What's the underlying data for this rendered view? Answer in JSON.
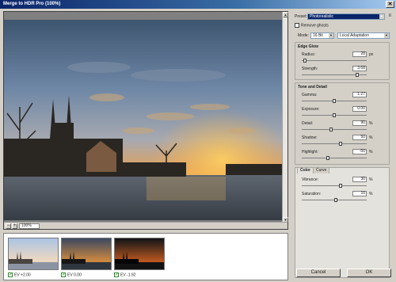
{
  "window": {
    "title": "Merge to HDR Pro (100%)",
    "close_label": "✕"
  },
  "preview": {
    "zoom": "100%",
    "zoom_minus": "−",
    "zoom_plus": "+"
  },
  "filmstrip": [
    {
      "label": "EV +2.00",
      "checked": true
    },
    {
      "label": "EV 0.00",
      "checked": true
    },
    {
      "label": "EV -1.92",
      "checked": true
    }
  ],
  "panel": {
    "preset_label": "Preset:",
    "preset_value": "Photorealistic",
    "remove_ghosts_label": "Remove ghosts",
    "mode_label": "Mode:",
    "mode_value": "16 Bit",
    "method_value": "Local Adaptation",
    "edge_glow": {
      "title": "Edge Glow",
      "radius": {
        "label": "Radius:",
        "value": "28",
        "unit": "px",
        "level": 0.05
      },
      "strength": {
        "label": "Strength:",
        "value": "3.68",
        "unit": "",
        "level": 0.85
      }
    },
    "tone_detail": {
      "title": "Tone and Detail",
      "gamma": {
        "label": "Gamma:",
        "value": "1.27",
        "unit": "",
        "level": 0.5
      },
      "exposure": {
        "label": "Exposure:",
        "value": "0.00",
        "unit": "",
        "level": 0.5
      },
      "detail": {
        "label": "Detail:",
        "value": "90",
        "unit": "%",
        "level": 0.45
      },
      "shadow": {
        "label": "Shadow:",
        "value": "50",
        "unit": "%",
        "level": 0.6
      },
      "highlight": {
        "label": "Highlight:",
        "value": "-50",
        "unit": "%",
        "level": 0.4
      }
    },
    "tabs": {
      "color": "Color",
      "curve": "Curve"
    },
    "color": {
      "vibrance": {
        "label": "Vibrance:",
        "value": "30",
        "unit": "%",
        "level": 0.6
      },
      "saturation": {
        "label": "Saturation:",
        "value": "10",
        "unit": "%",
        "level": 0.52
      }
    },
    "cancel_label": "Cancel",
    "ok_label": "OK"
  }
}
